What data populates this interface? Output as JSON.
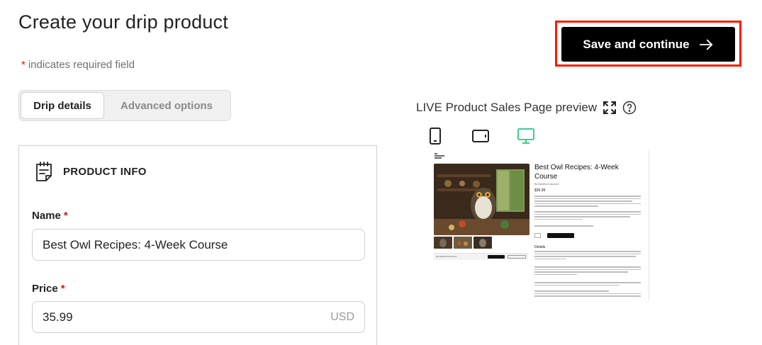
{
  "page": {
    "title": "Create your drip product",
    "required_note": {
      "star": "*",
      "text": "indicates required field"
    },
    "save_button": "Save and continue"
  },
  "tabs": [
    {
      "label": "Drip details",
      "active": true
    },
    {
      "label": "Advanced options",
      "active": false
    }
  ],
  "product_info": {
    "heading": "PRODUCT INFO",
    "name": {
      "label": "Name",
      "required": "*",
      "value": "Best Owl Recipes: 4-Week Course"
    },
    "price": {
      "label": "Price",
      "required": "*",
      "value": "35.99",
      "currency": "USD"
    }
  },
  "preview": {
    "label": "LIVE Product Sales Page preview",
    "devices": [
      {
        "name": "phone",
        "active": false
      },
      {
        "name": "tablet",
        "active": false
      },
      {
        "name": "desktop",
        "active": true
      }
    ],
    "product_title": "Best Owl Recipes: 4-Week Course",
    "author": "By Sandbox3 Account",
    "price": "$35.99",
    "details_heading": "Details"
  },
  "colors": {
    "accent_highlight": "#ff1a00",
    "button_bg": "#000000",
    "required_star": "#dd1111",
    "active_device": "#3ccf8e"
  }
}
